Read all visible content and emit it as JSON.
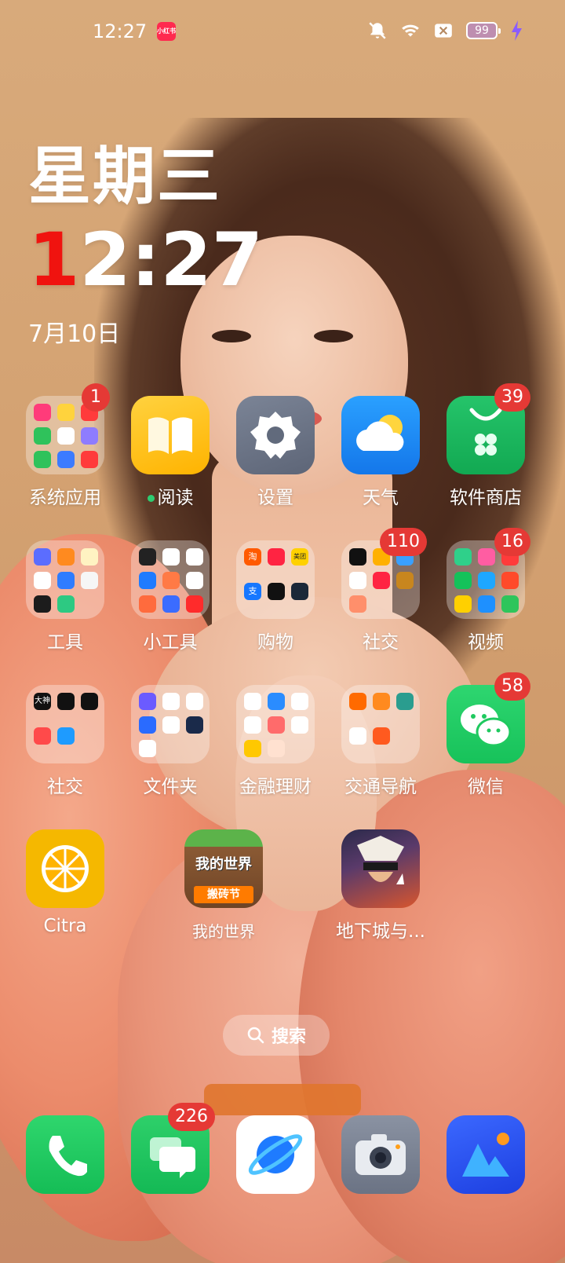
{
  "status_bar": {
    "time": "12:27",
    "notification_app": "小红书",
    "battery": "99",
    "icons": [
      "mute-bell-icon",
      "wifi-icon",
      "sim-x-icon",
      "battery-icon",
      "charging-bolt-icon"
    ]
  },
  "clock_widget": {
    "weekday": "星期三",
    "time_first_digit": "1",
    "time_rest": "2:27",
    "date": "7月10日"
  },
  "apps": {
    "row1": [
      {
        "label": "系统应用",
        "type": "folder",
        "badge": "1"
      },
      {
        "label": "阅读",
        "type": "app",
        "badge": "",
        "new_dot": true
      },
      {
        "label": "设置",
        "type": "app",
        "badge": ""
      },
      {
        "label": "天气",
        "type": "app",
        "badge": ""
      },
      {
        "label": "软件商店",
        "type": "app",
        "badge": "39"
      }
    ],
    "row2": [
      {
        "label": "工具",
        "type": "folder",
        "badge": ""
      },
      {
        "label": "小工具",
        "type": "folder",
        "badge": ""
      },
      {
        "label": "购物",
        "type": "folder",
        "badge": "",
        "mini_labels": [
          "淘",
          "美团",
          "支"
        ]
      },
      {
        "label": "社交",
        "type": "folder",
        "badge": "110"
      },
      {
        "label": "视频",
        "type": "folder",
        "badge": "16"
      }
    ],
    "row3": [
      {
        "label": "社交",
        "type": "folder",
        "badge": "",
        "mini_labels": [
          "大神"
        ]
      },
      {
        "label": "文件夹",
        "type": "folder",
        "badge": ""
      },
      {
        "label": "金融理财",
        "type": "folder",
        "badge": ""
      },
      {
        "label": "交通导航",
        "type": "folder",
        "badge": ""
      },
      {
        "label": "微信",
        "type": "app",
        "badge": "58"
      }
    ],
    "row4": [
      {
        "label": "Citra",
        "type": "app",
        "badge": ""
      },
      {
        "label": "我的世界",
        "type": "app",
        "badge": "",
        "art_title": "我的世界",
        "art_sub": "搬砖节"
      },
      {
        "label": "地下城与...",
        "type": "app",
        "badge": ""
      }
    ]
  },
  "search": {
    "label": "搜索"
  },
  "dock": [
    {
      "name": "phone",
      "badge": ""
    },
    {
      "name": "messages",
      "badge": "226"
    },
    {
      "name": "browser",
      "badge": ""
    },
    {
      "name": "camera",
      "badge": ""
    },
    {
      "name": "gallery",
      "badge": ""
    }
  ],
  "colors": {
    "badge": "#e53935",
    "clock_accent": "#f0130f",
    "settings": "#6d7585",
    "weather": "#1e8cf5",
    "store": "#18b85a",
    "wechat": "#1fc95f",
    "citra": "#f5b800",
    "reading": "#ffc21a"
  }
}
